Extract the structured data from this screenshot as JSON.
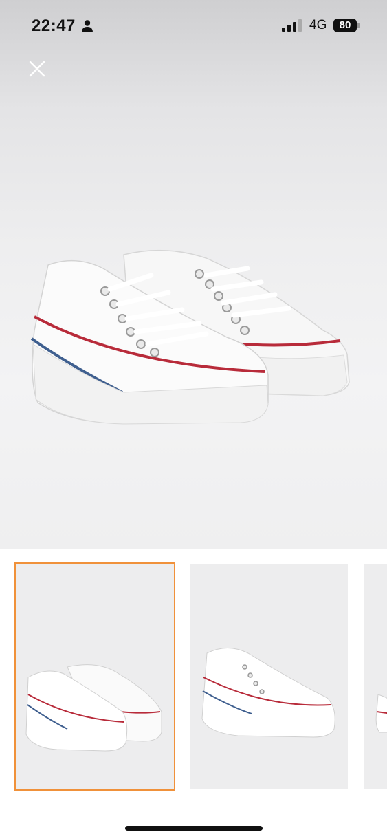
{
  "status_bar": {
    "time": "22:47",
    "network": "4G",
    "battery": "80"
  },
  "icons": {
    "close": "close-icon",
    "person": "person-icon",
    "signal": "signal-bars-icon"
  },
  "gallery": {
    "thumbnails": [
      {
        "selected": true
      },
      {
        "selected": false
      },
      {
        "selected": false
      }
    ],
    "accent_color": "#f0913a"
  }
}
